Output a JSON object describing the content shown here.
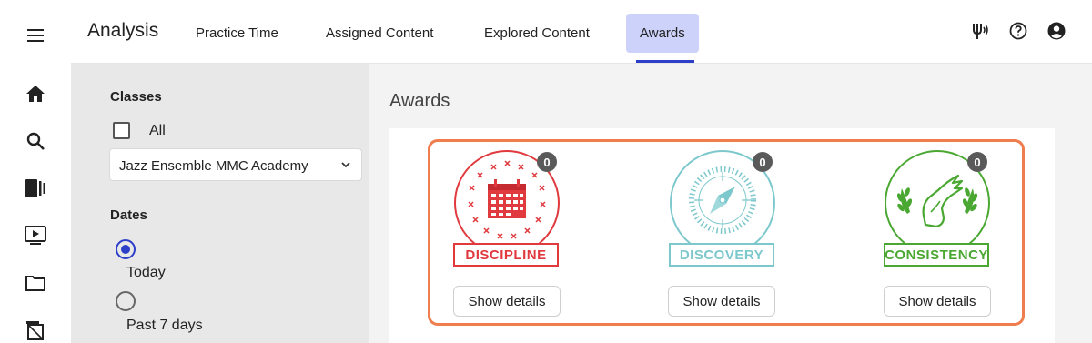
{
  "header": {
    "title": "Analysis",
    "tabs": [
      {
        "label": "Practice Time"
      },
      {
        "label": "Assigned Content"
      },
      {
        "label": "Explored Content"
      },
      {
        "label": "Awards",
        "active": true
      }
    ]
  },
  "icons": {
    "rail": [
      "menu-icon",
      "home-icon",
      "search-icon",
      "library-icon",
      "video-icon",
      "folder-icon",
      "assignment-icon"
    ],
    "topbar": [
      "tuner-icon",
      "help-icon",
      "account-icon"
    ]
  },
  "filters": {
    "classes_label": "Classes",
    "all_label": "All",
    "all_checked": false,
    "class_select_value": "Jazz Ensemble MMC Academy",
    "dates_label": "Dates",
    "date_options": [
      {
        "label": "Today",
        "selected": true
      },
      {
        "label": "Past 7 days",
        "selected": false
      }
    ]
  },
  "main": {
    "title": "Awards",
    "awards": [
      {
        "label": "DISCIPLINE",
        "count": "0",
        "button": "Show details",
        "color": "#e0393e"
      },
      {
        "label": "DISCOVERY",
        "count": "0",
        "button": "Show details",
        "color": "#7cc8cc"
      },
      {
        "label": "CONSISTENCY",
        "count": "0",
        "button": "Show details",
        "color": "#4aa832"
      }
    ]
  },
  "colors": {
    "accent": "#2d3ec9",
    "active_tab_bg": "#cdd2fa",
    "highlight_border": "#ef7d4e"
  }
}
